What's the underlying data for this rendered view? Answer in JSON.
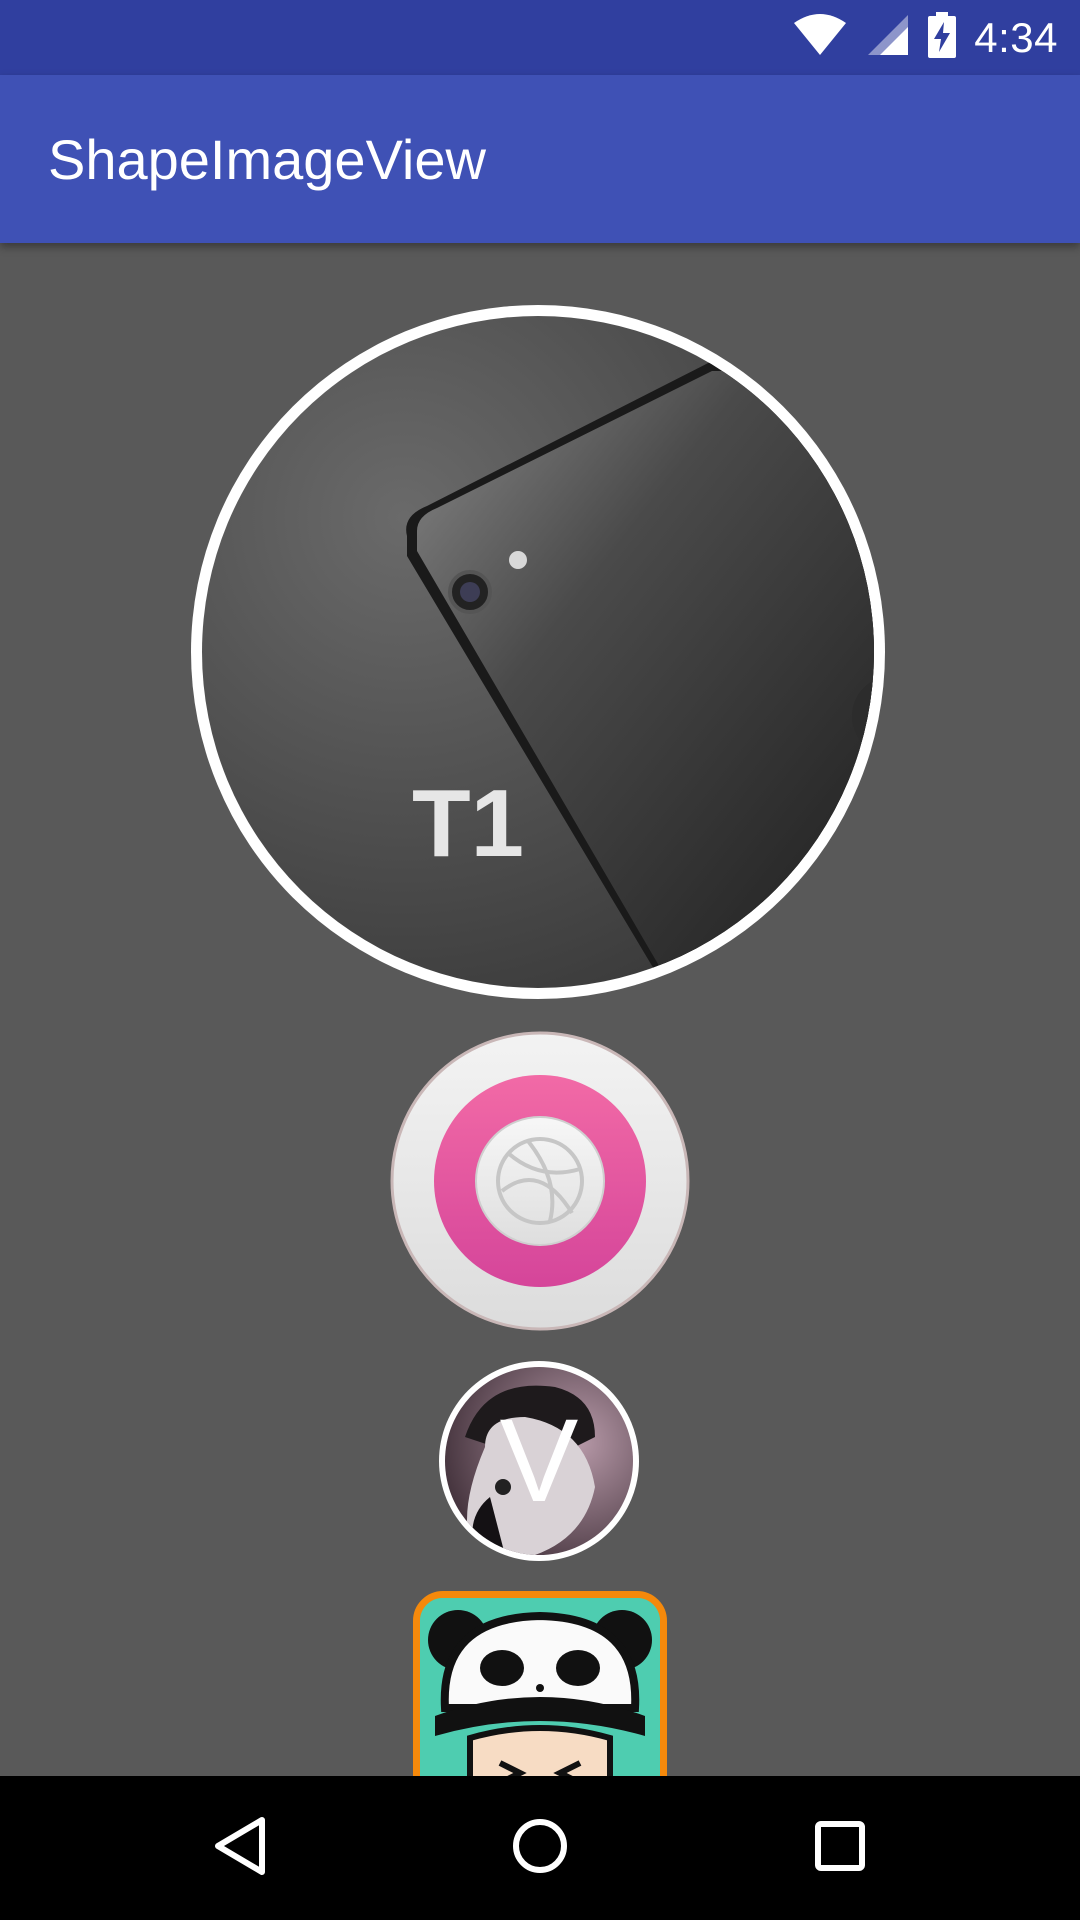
{
  "status_bar": {
    "time": "4:34",
    "icons": [
      "wifi-icon",
      "cell-signal-icon",
      "battery-charging-icon"
    ]
  },
  "app_bar": {
    "title": "ShapeImageView"
  },
  "images": [
    {
      "name": "circle-image-phone",
      "caption_text": "T1"
    },
    {
      "name": "circle-image-dribbble-logo"
    },
    {
      "name": "circle-image-avatar",
      "overlay_text": "V"
    },
    {
      "name": "rounded-rect-image-panda-cartoon"
    }
  ],
  "nav_bar": {
    "icons": [
      "back-icon",
      "home-icon",
      "recents-icon"
    ]
  },
  "colors": {
    "status_bar": "#303F9F",
    "app_bar": "#3F51B5",
    "background": "#595959",
    "frame_border": "#FFFFFF",
    "rounded_border": "#F5890B"
  }
}
